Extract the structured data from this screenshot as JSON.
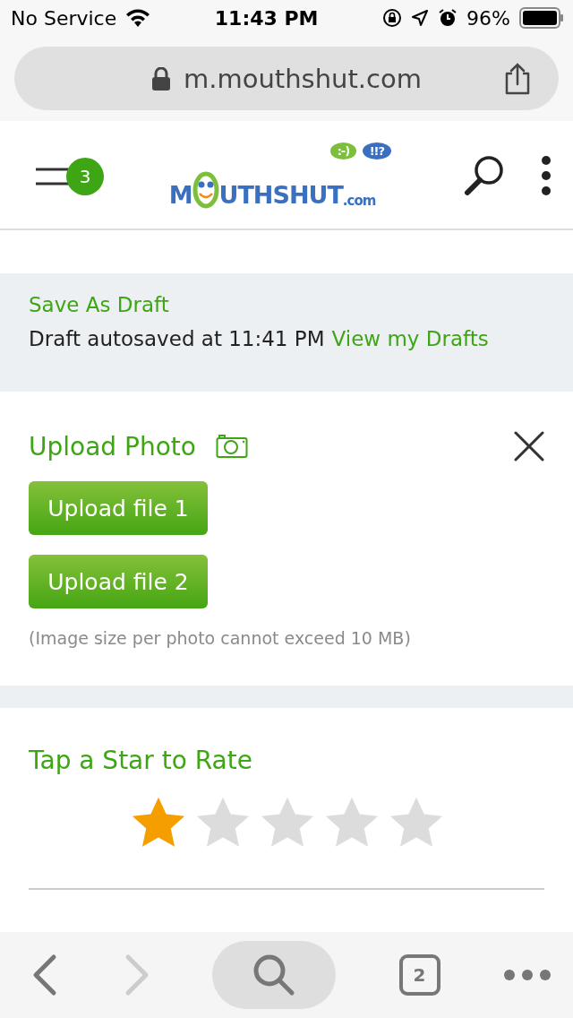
{
  "status_bar": {
    "carrier": "No Service",
    "time": "11:43 PM",
    "battery": "96%"
  },
  "address_bar": {
    "url": "m.mouthshut.com"
  },
  "header": {
    "menu_badge": "3",
    "logo": {
      "first": "M",
      "rest": "UTHSHUT",
      "suffix": ".com",
      "bubble_1": ":-)",
      "bubble_2": "!!?"
    }
  },
  "draft": {
    "title": "Save As Draft",
    "status": "Draft autosaved at 11:41 PM",
    "link": "View my Drafts"
  },
  "upload": {
    "title": "Upload Photo",
    "buttons": [
      "Upload file 1",
      "Upload file 2"
    ],
    "note": "(Image size per photo cannot exceed 10 MB)"
  },
  "rating": {
    "title": "Tap a Star to Rate",
    "stars": 1
  },
  "toolbar": {
    "back_disabled": false,
    "forward_disabled": true,
    "tabs_count": "2"
  }
}
